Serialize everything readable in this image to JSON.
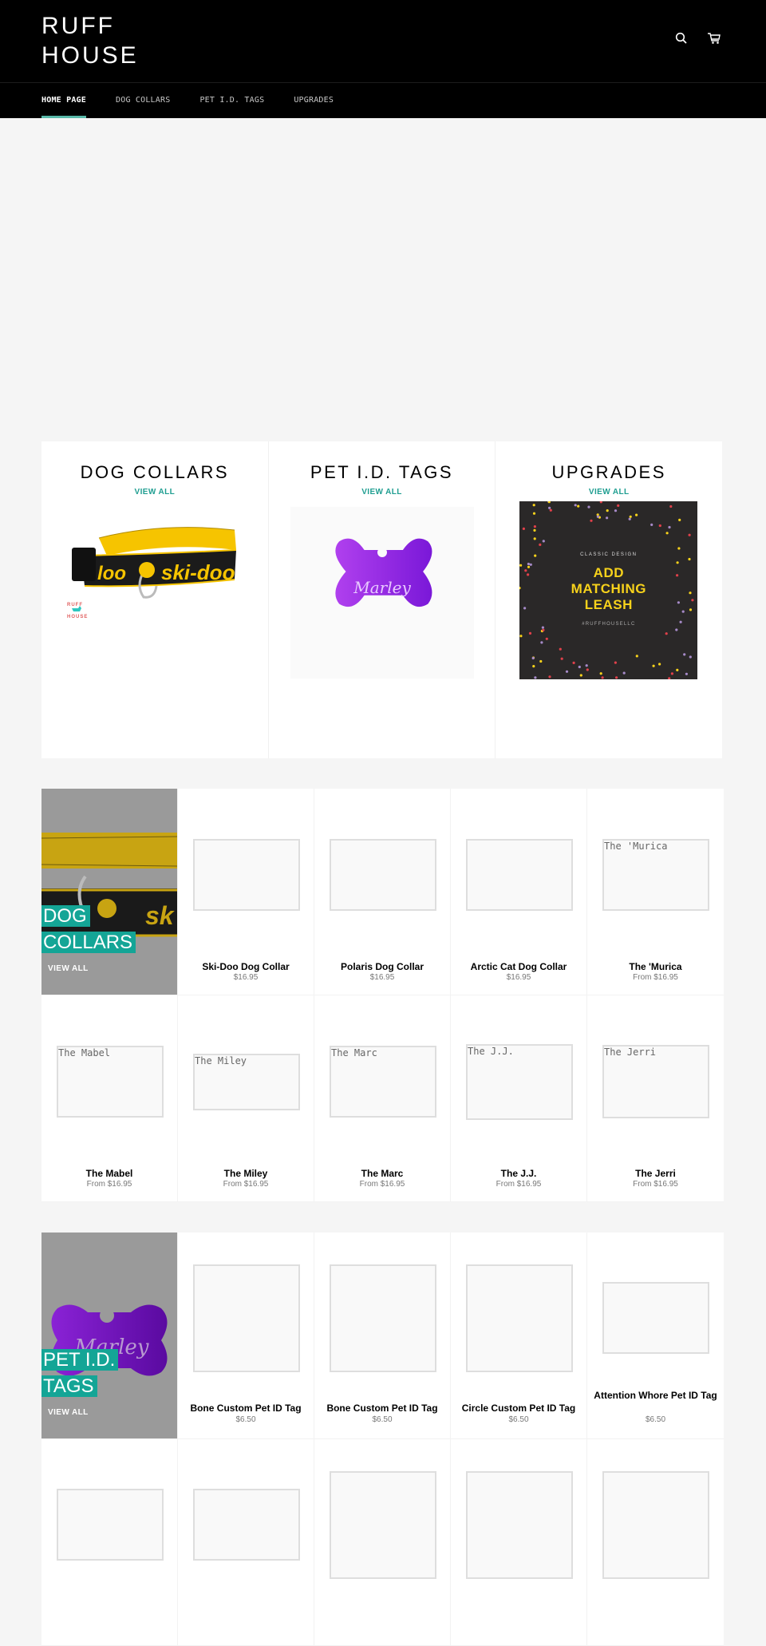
{
  "header": {
    "logo_line1": "RUFF",
    "logo_line2": "HOUSE",
    "icons": [
      "search-icon",
      "cart-icon"
    ]
  },
  "nav": {
    "items": [
      {
        "label": "HOME PAGE",
        "active": true
      },
      {
        "label": "DOG COLLARS",
        "active": false
      },
      {
        "label": "PET I.D. TAGS",
        "active": false
      },
      {
        "label": "UPGRADES",
        "active": false
      }
    ]
  },
  "colors": {
    "accent": "#1f9e91",
    "nav_underline": "#58b8a8",
    "hero_label_bg": "#14a596",
    "header_bg": "#000000",
    "page_bg": "#f5f5f5"
  },
  "featured": [
    {
      "title": "DOG COLLARS",
      "link": "VIEW ALL",
      "image_alt": "Ski-Doo dog collar with Ruff House logo"
    },
    {
      "title": "PET I.D. TAGS",
      "link": "VIEW ALL",
      "image_alt": "Purple bone tag engraved Marley",
      "engraving": "Marley"
    },
    {
      "title": "UPGRADES",
      "link": "VIEW ALL",
      "image": {
        "kicker": "CLASSIC DESIGN",
        "headline": "ADD MATCHING LEASH",
        "hashtag": "#RUFFHOUSELLC"
      }
    }
  ],
  "collars_section": {
    "hero_title_line1": "DOG",
    "hero_title_line2": "COLLARS",
    "hero_link": "VIEW ALL",
    "products": [
      {
        "title": "Ski-Doo Dog Collar",
        "price": "$16.95",
        "placeholder": ""
      },
      {
        "title": "Polaris Dog Collar",
        "price": "$16.95",
        "placeholder": ""
      },
      {
        "title": "Arctic Cat Dog Collar",
        "price": "$16.95",
        "placeholder": ""
      },
      {
        "title": "The 'Murica",
        "price": "From $16.95",
        "placeholder": "The 'Murica"
      },
      {
        "title": "The Mabel",
        "price": "From $16.95",
        "placeholder": "The Mabel"
      },
      {
        "title": "The Miley",
        "price": "From $16.95",
        "placeholder": "The Miley"
      },
      {
        "title": "The Marc",
        "price": "From $16.95",
        "placeholder": "The Marc"
      },
      {
        "title": "The J.J.",
        "price": "From $16.95",
        "placeholder": "The J.J."
      },
      {
        "title": "The Jerri",
        "price": "From $16.95",
        "placeholder": "The Jerri"
      }
    ]
  },
  "tags_section": {
    "hero_title_line1": "PET I.D.",
    "hero_title_line2": "TAGS",
    "hero_link": "VIEW ALL",
    "hero_engraving": "Marley",
    "products": [
      {
        "title": "Bone Custom Pet ID Tag",
        "price": "$6.50"
      },
      {
        "title": "Bone Custom Pet ID Tag",
        "price": "$6.50"
      },
      {
        "title": "Circle Custom Pet ID Tag",
        "price": "$6.50"
      },
      {
        "title": "Attention Whore Pet ID Tag",
        "price": "$6.50"
      }
    ]
  }
}
